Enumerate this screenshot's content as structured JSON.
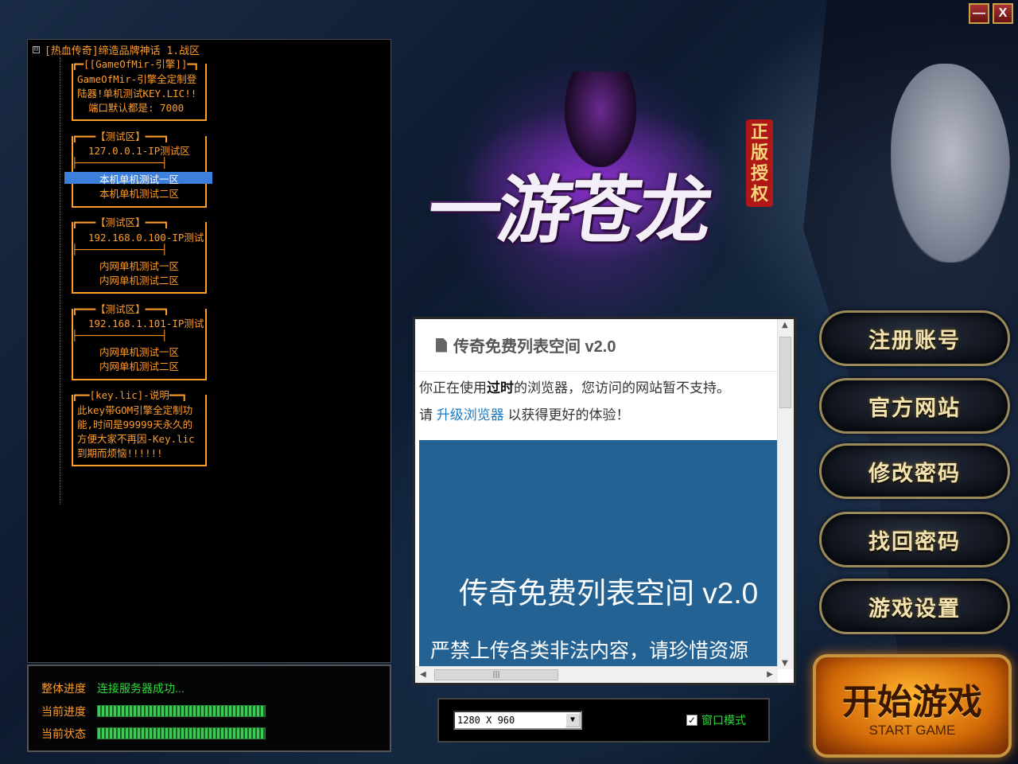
{
  "window": {
    "minimize_label": "—",
    "close_label": "X"
  },
  "logo": {
    "title": "一游苍龙",
    "seal": [
      "正",
      "版",
      "授",
      "权"
    ]
  },
  "tree": {
    "root_label": "[热血传奇]缔造品牌神话 1.战区",
    "expander": "⊟",
    "boxes": [
      {
        "header": "┏━[[GameOfMir-引擎]]━┓",
        "lines": [
          "GameOfMir-引擎全定制登",
          "陆器!单机测试KEY.LIC!!",
          "端口默认都是: 7000"
        ]
      },
      {
        "header": "┏━━━【测试区】━━━┓",
        "lines": [
          "127.0.0.1-IP测试区",
          "├──────────────┤",
          "本机单机测试一区",
          "本机单机测试二区"
        ]
      },
      {
        "header": "┏━━━【测试区】━━━┓",
        "lines": [
          "192.168.0.100-IP测试",
          "├──────────────┤",
          "内网单机测试一区",
          "内网单机测试二区"
        ]
      },
      {
        "header": "┏━━━【测试区】━━━┓",
        "lines": [
          "192.168.1.101-IP测试",
          "├──────────────┤",
          "内网单机测试一区",
          "内网单机测试二区"
        ]
      },
      {
        "header": "┏━━[key.lic]-说明━━┓",
        "lines": [
          "此key带GOM引擎全定制功",
          "能,时间是99999天永久的",
          "方便大家不再因-Key.lic",
          "到期而烦恼!!!!!!"
        ]
      }
    ],
    "selected_item": "本机单机测试一区"
  },
  "status": {
    "overall_label": "整体进度",
    "overall_value": "连接服务器成功...",
    "current_progress_label": "当前进度",
    "current_state_label": "当前状态",
    "current_progress": 1.0,
    "current_state": 1.0
  },
  "browser": {
    "title": "传奇免费列表空间 v2.0",
    "notice_prefix": "你正在使用",
    "notice_bold": "过时",
    "notice_suffix": "的浏览器，您访问的网站暂不支持。",
    "line2_prefix": "请 ",
    "upgrade_link": "升级浏览器",
    "line2_suffix": " 以获得更好的体验！",
    "hero_title": "传奇免费列表空间 v2.0",
    "hero_sub": "严禁上传各类非法内容，请珍惜资源"
  },
  "settings": {
    "resolution": "1280 X 960",
    "window_mode_label": "窗口模式",
    "window_mode_checked": true
  },
  "menu": {
    "register": "注册账号",
    "website": "官方网站",
    "change_password": "修改密码",
    "recover_password": "找回密码",
    "game_settings": "游戏设置"
  },
  "start": {
    "label_cn": "开始游戏",
    "label_en": "START GAME"
  },
  "colors": {
    "tree_text": "#ff9d2a",
    "status_ok": "#2adf3a",
    "selection": "#3c7fdd",
    "hero": "#236293"
  }
}
